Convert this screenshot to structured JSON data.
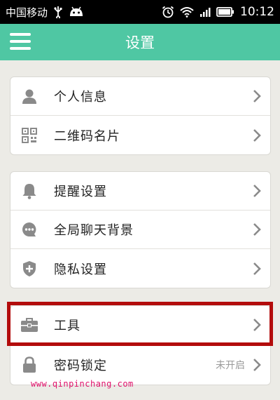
{
  "status_bar": {
    "carrier": "中国移动",
    "time": "10:12"
  },
  "app_bar": {
    "title": "设置",
    "menu_icon": "menu-icon"
  },
  "groups": [
    {
      "items": [
        {
          "label": "个人信息",
          "icon": "person-icon"
        },
        {
          "label": "二维码名片",
          "icon": "qr-code-icon"
        }
      ]
    },
    {
      "items": [
        {
          "label": "提醒设置",
          "icon": "bell-icon"
        },
        {
          "label": "全局聊天背景",
          "icon": "chat-bubble-icon"
        },
        {
          "label": "隐私设置",
          "icon": "shield-icon"
        }
      ]
    },
    {
      "items": [
        {
          "label": "工具",
          "icon": "toolbox-icon"
        },
        {
          "label": "密码锁定",
          "icon": "lock-icon",
          "value": "未开启"
        }
      ]
    }
  ],
  "watermark": "www.qinpinchang.com",
  "colors": {
    "accent": "#4fc7a3",
    "icon_gray": "#8a8a8a",
    "highlight": "#b30c0c",
    "watermark": "#e0106a"
  }
}
